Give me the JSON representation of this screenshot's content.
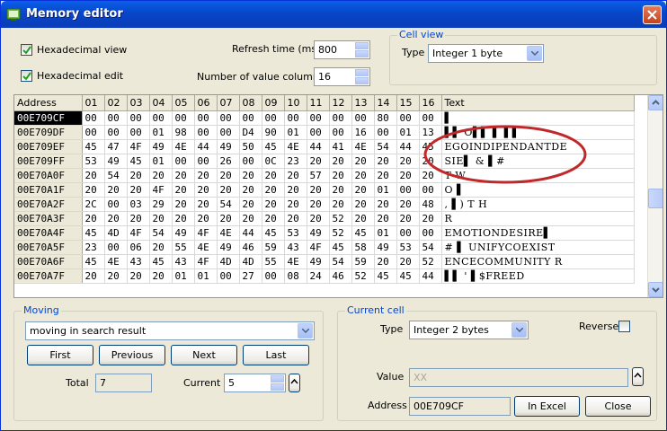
{
  "window": {
    "title": "Memory editor"
  },
  "options": {
    "hex_view_label": "Hexadecimal view",
    "hex_edit_label": "Hexadecimal edit",
    "refresh_label": "Refresh time (ms)",
    "refresh_value": "800",
    "columns_label": "Number of value columns",
    "columns_value": "16"
  },
  "cell_view": {
    "group_title": "Cell view",
    "type_label": "Type",
    "type_value": "Integer 1 byte"
  },
  "grid": {
    "headers": [
      "Address",
      "01",
      "02",
      "03",
      "04",
      "05",
      "06",
      "07",
      "08",
      "09",
      "10",
      "11",
      "12",
      "13",
      "14",
      "15",
      "16",
      "Text"
    ],
    "rows": [
      {
        "addr": "00E709CF",
        "bytes": [
          "00",
          "00",
          "00",
          "00",
          "00",
          "00",
          "00",
          "00",
          "00",
          "00",
          "00",
          "00",
          "00",
          "80",
          "00",
          "00"
        ],
        "text": "               ▌"
      },
      {
        "addr": "00E709DF",
        "bytes": [
          "00",
          "00",
          "00",
          "01",
          "98",
          "00",
          "00",
          "D4",
          "90",
          "01",
          "00",
          "00",
          "16",
          "00",
          "01",
          "13"
        ],
        "text": "   ▌▌   O▌▌  ▌ ▌▌"
      },
      {
        "addr": "00E709EF",
        "bytes": [
          "45",
          "47",
          "4F",
          "49",
          "4E",
          "44",
          "49",
          "50",
          "45",
          "4E",
          "44",
          "41",
          "4E",
          "54",
          "44",
          "45"
        ],
        "text": "EGOINDIPENDANTDE"
      },
      {
        "addr": "00E709FF",
        "bytes": [
          "53",
          "49",
          "45",
          "01",
          "00",
          "00",
          "26",
          "00",
          "0C",
          "23",
          "20",
          "20",
          "20",
          "20",
          "20",
          "20"
        ],
        "text": "SIE▌  & ▌#"
      },
      {
        "addr": "00E70A0F",
        "bytes": [
          "20",
          "54",
          "20",
          "20",
          "20",
          "20",
          "20",
          "20",
          "20",
          "20",
          "57",
          "20",
          "20",
          "20",
          "20",
          "20"
        ],
        "text": " T         W"
      },
      {
        "addr": "00E70A1F",
        "bytes": [
          "20",
          "20",
          "20",
          "4F",
          "20",
          "20",
          "20",
          "20",
          "20",
          "20",
          "20",
          "20",
          "20",
          "01",
          "00",
          "00"
        ],
        "text": "   O         ▌"
      },
      {
        "addr": "00E70A2F",
        "bytes": [
          "2C",
          "00",
          "03",
          "29",
          "20",
          "20",
          "54",
          "20",
          "20",
          "20",
          "20",
          "20",
          "20",
          "20",
          "20",
          "48"
        ],
        "text": ", ▌) T        H"
      },
      {
        "addr": "00E70A3F",
        "bytes": [
          "20",
          "20",
          "20",
          "20",
          "20",
          "20",
          "20",
          "20",
          "20",
          "20",
          "20",
          "52",
          "20",
          "20",
          "20",
          "20"
        ],
        "text": "           R"
      },
      {
        "addr": "00E70A4F",
        "bytes": [
          "45",
          "4D",
          "4F",
          "54",
          "49",
          "4F",
          "4E",
          "44",
          "45",
          "53",
          "49",
          "52",
          "45",
          "01",
          "00",
          "00"
        ],
        "text": "EMOTIONDESIRE▌"
      },
      {
        "addr": "00E70A5F",
        "bytes": [
          "23",
          "00",
          "06",
          "20",
          "55",
          "4E",
          "49",
          "46",
          "59",
          "43",
          "4F",
          "45",
          "58",
          "49",
          "53",
          "54"
        ],
        "text": "# ▌ UNIFYCOEXIST"
      },
      {
        "addr": "00E70A6F",
        "bytes": [
          "45",
          "4E",
          "43",
          "45",
          "43",
          "4F",
          "4D",
          "4D",
          "55",
          "4E",
          "49",
          "54",
          "59",
          "20",
          "20",
          "52"
        ],
        "text": "ENCECOMMUNITY  R"
      },
      {
        "addr": "00E70A7F",
        "bytes": [
          "20",
          "20",
          "20",
          "20",
          "01",
          "01",
          "00",
          "27",
          "00",
          "08",
          "24",
          "46",
          "52",
          "45",
          "45",
          "44"
        ],
        "text": "    ▌▌ ' ▌$FREED"
      }
    ]
  },
  "moving": {
    "group_title": "Moving",
    "mode_value": "moving in search result",
    "first_label": "First",
    "previous_label": "Previous",
    "next_label": "Next",
    "last_label": "Last",
    "total_label": "Total",
    "total_value": "7",
    "current_label": "Current",
    "current_value": "5"
  },
  "current_cell": {
    "group_title": "Current cell",
    "type_label": "Type",
    "type_value": "Integer 2 bytes",
    "reverse_label": "Reverse",
    "value_label": "Value",
    "value_text": "XX",
    "address_label": "Address",
    "address_value": "00E709CF",
    "in_excel_label": "In Excel",
    "close_label": "Close"
  },
  "colors": {
    "title_bar": "#0846c8",
    "annotation_circle": "#c0282a",
    "selected_address": "#000000"
  }
}
